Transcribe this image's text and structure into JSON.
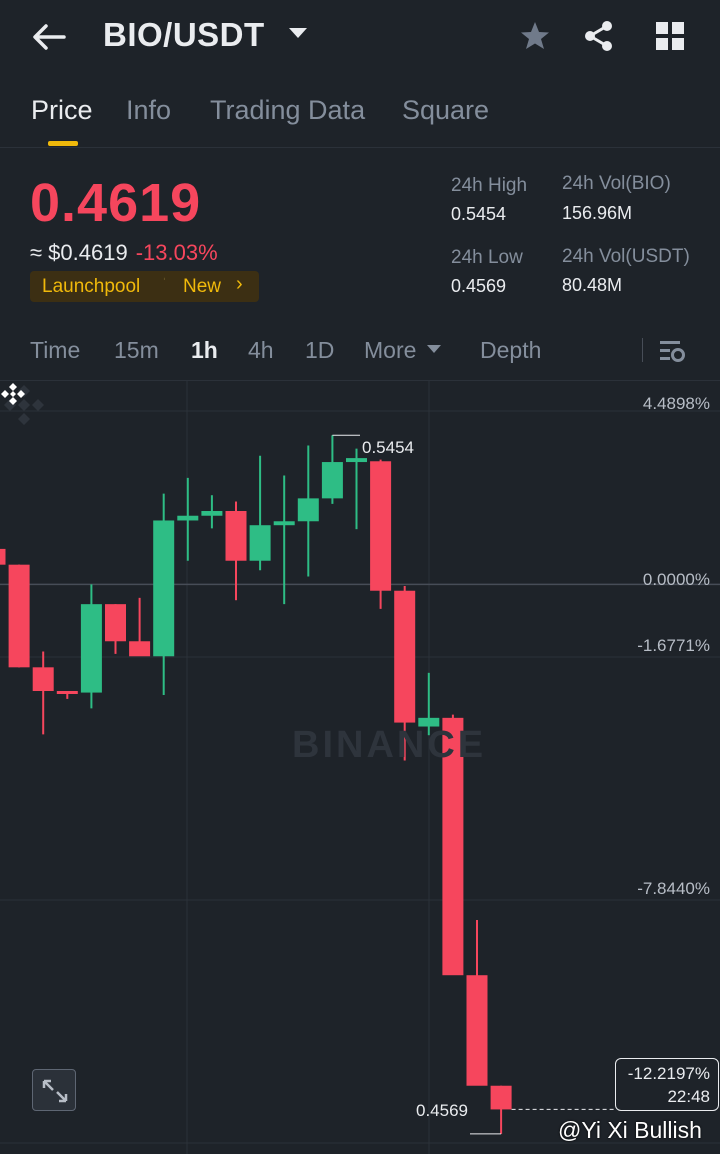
{
  "header": {
    "pair": "BIO/USDT",
    "icons": [
      "back-arrow-icon",
      "favorite-star-icon",
      "share-icon",
      "grid-menu-icon"
    ]
  },
  "tabs": [
    {
      "label": "Price",
      "active": true
    },
    {
      "label": "Info",
      "active": false
    },
    {
      "label": "Trading Data",
      "active": false
    },
    {
      "label": "Square",
      "active": false
    }
  ],
  "ticker": {
    "last_price": "0.4619",
    "usd_value": "≈ $0.4619",
    "change_pct": "-13.03%",
    "tag_label": "Launchpool",
    "tag_new": "New",
    "high_label": "24h High",
    "high_value": "0.5454",
    "low_label": "24h Low",
    "low_value": "0.4569",
    "vol_base_label": "24h Vol(BIO)",
    "vol_base_value": "156.96M",
    "vol_quote_label": "24h Vol(USDT)",
    "vol_quote_value": "80.48M"
  },
  "intervals": {
    "items": [
      {
        "label": "Time",
        "active": false
      },
      {
        "label": "15m",
        "active": false
      },
      {
        "label": "1h",
        "active": true
      },
      {
        "label": "4h",
        "active": false
      },
      {
        "label": "1D",
        "active": false
      },
      {
        "label": "More",
        "active": false
      },
      {
        "label": "Depth",
        "active": false
      }
    ],
    "settings_icon": "chart-settings-icon"
  },
  "chart": {
    "watermark": "BINANCE",
    "pct_scale": [
      "4.4898%",
      "0.0000%",
      "-1.6771%",
      "-7.8440%"
    ],
    "high_marker": "0.5454",
    "low_marker": "0.4569",
    "current_pct": "-12.2197%",
    "countdown": "22:48",
    "credit": "@Yi Xi Bullish",
    "colors": {
      "up": "#2ebd85",
      "down": "#f6465d",
      "accent": "#f0b90b"
    }
  },
  "chart_data": {
    "type": "candlestick",
    "interval": "1h",
    "candles": [
      {
        "o": 0.531,
        "h": 0.532,
        "l": 0.524,
        "c": 0.529
      },
      {
        "o": 0.529,
        "h": 0.529,
        "l": 0.516,
        "c": 0.516
      },
      {
        "o": 0.516,
        "h": 0.518,
        "l": 0.5075,
        "c": 0.513
      },
      {
        "o": 0.513,
        "h": 0.513,
        "l": 0.512,
        "c": 0.5128
      },
      {
        "o": 0.5128,
        "h": 0.5265,
        "l": 0.5108,
        "c": 0.524
      },
      {
        "o": 0.524,
        "h": 0.524,
        "l": 0.5177,
        "c": 0.5193
      },
      {
        "o": 0.5193,
        "h": 0.5248,
        "l": 0.5183,
        "c": 0.5174
      },
      {
        "o": 0.5174,
        "h": 0.538,
        "l": 0.5125,
        "c": 0.5346
      },
      {
        "o": 0.5346,
        "h": 0.54,
        "l": 0.5295,
        "c": 0.5352
      },
      {
        "o": 0.5352,
        "h": 0.5378,
        "l": 0.5336,
        "c": 0.5358
      },
      {
        "o": 0.5358,
        "h": 0.537,
        "l": 0.5245,
        "c": 0.5295
      },
      {
        "o": 0.5295,
        "h": 0.5428,
        "l": 0.5283,
        "c": 0.534
      },
      {
        "o": 0.534,
        "h": 0.5403,
        "l": 0.524,
        "c": 0.5345
      },
      {
        "o": 0.5345,
        "h": 0.5441,
        "l": 0.5275,
        "c": 0.5374
      },
      {
        "o": 0.5374,
        "h": 0.5454,
        "l": 0.5367,
        "c": 0.542
      },
      {
        "o": 0.542,
        "h": 0.5437,
        "l": 0.5335,
        "c": 0.5425
      },
      {
        "o": 0.5421,
        "h": 0.5423,
        "l": 0.5234,
        "c": 0.5257
      },
      {
        "o": 0.5257,
        "h": 0.5263,
        "l": 0.5042,
        "c": 0.509
      },
      {
        "o": 0.5085,
        "h": 0.5153,
        "l": 0.5074,
        "c": 0.5096
      },
      {
        "o": 0.5096,
        "h": 0.51,
        "l": 0.486,
        "c": 0.477
      },
      {
        "o": 0.477,
        "h": 0.484,
        "l": 0.4655,
        "c": 0.463
      },
      {
        "o": 0.463,
        "h": 0.463,
        "l": 0.4569,
        "c": 0.46
      }
    ],
    "last_close": 0.4619,
    "reference_price": 0.5265,
    "ylim": [
      0.456,
      0.551
    ]
  }
}
